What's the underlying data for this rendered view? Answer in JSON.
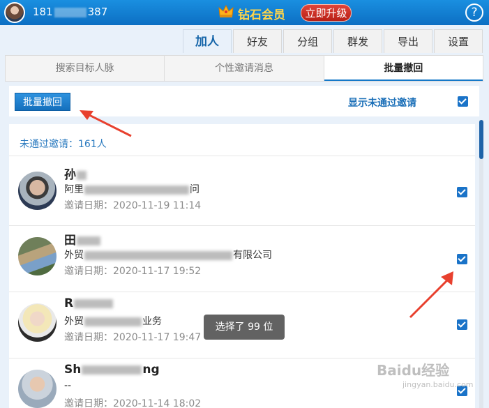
{
  "header": {
    "phone_prefix": "181",
    "phone_suffix": "387",
    "vip_label": "钻石会员",
    "upgrade_label": "立即升级",
    "help_glyph": "?"
  },
  "tabs": [
    {
      "label": "加人",
      "active": true
    },
    {
      "label": "好友"
    },
    {
      "label": "分组"
    },
    {
      "label": "群发"
    },
    {
      "label": "导出"
    },
    {
      "label": "设置"
    }
  ],
  "subtabs": [
    {
      "label": "搜索目标人脉"
    },
    {
      "label": "个性邀请消息"
    },
    {
      "label": "批量撤回",
      "active": true
    }
  ],
  "actions": {
    "batch_button": "批量撤回",
    "show_link": "显示未通过邀请",
    "show_checked": true
  },
  "summary": "未通过邀请：161人",
  "items": [
    {
      "name": "孙",
      "company_prefix": "阿里",
      "company_suffix": "问",
      "date": "邀请日期：2020-11-19 11:14",
      "checked": true
    },
    {
      "name": "田",
      "company_prefix": "外贸",
      "company_suffix": "有限公司",
      "date": "邀请日期：2020-11-17 19:52",
      "checked": true
    },
    {
      "name": "R",
      "company_prefix": "外贸",
      "company_suffix": "业务",
      "date": "邀请日期：2020-11-17 19:47",
      "checked": true
    },
    {
      "name": "Sh",
      "name_suffix": "ng",
      "company_prefix": "--",
      "company_suffix": "",
      "date": "邀请日期：2020-11-14 18:02",
      "checked": true
    }
  ],
  "toast": "选择了 99 位",
  "watermark": "Baidu经验",
  "watermark_sub": "jingyan.baidu.com",
  "colors": {
    "accent": "#1478c8",
    "header": "#0c6fc3",
    "vip": "#ffd54a",
    "arrow": "#e8402e"
  }
}
